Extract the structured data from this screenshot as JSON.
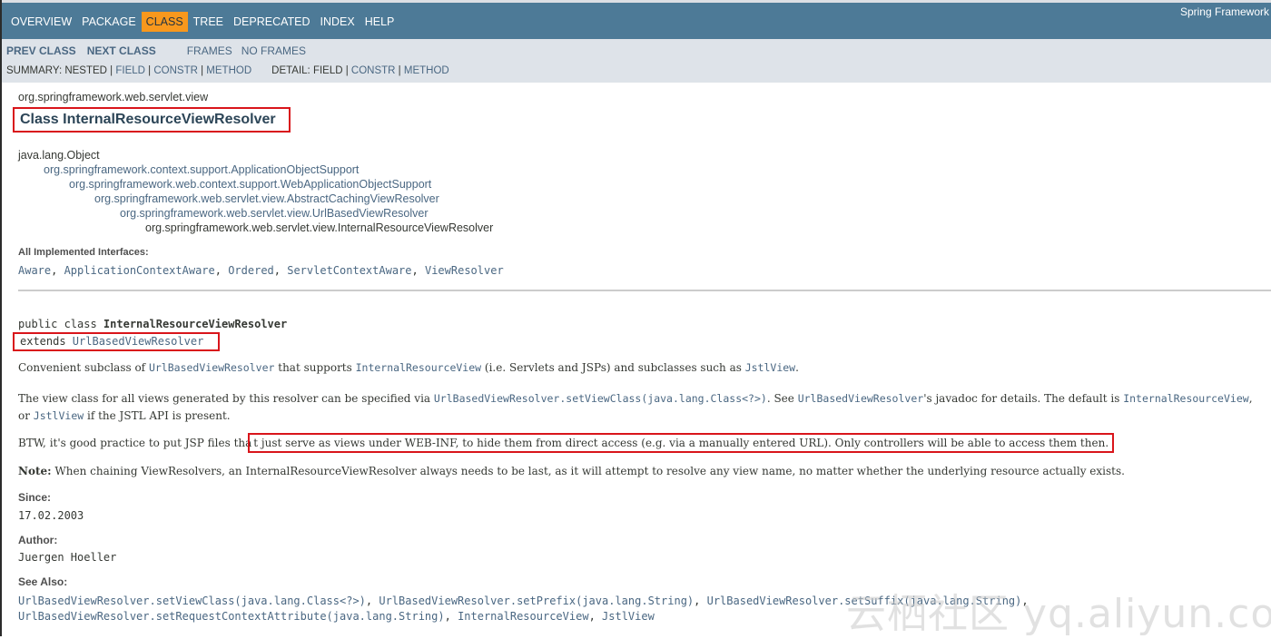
{
  "topnav": {
    "items": [
      {
        "label": "OVERVIEW",
        "active": false
      },
      {
        "label": "PACKAGE",
        "active": false
      },
      {
        "label": "CLASS",
        "active": true
      },
      {
        "label": "TREE",
        "active": false
      },
      {
        "label": "DEPRECATED",
        "active": false
      },
      {
        "label": "INDEX",
        "active": false
      },
      {
        "label": "HELP",
        "active": false
      }
    ],
    "brand": "Spring Framework"
  },
  "subnav": {
    "prev_class": "PREV CLASS",
    "next_class": "NEXT CLASS",
    "frames": "FRAMES",
    "no_frames": "NO FRAMES",
    "summary_label": "SUMMARY: NESTED | ",
    "summary_field": "FIELD",
    "sep": " | ",
    "summary_constr": "CONSTR",
    "summary_method": "METHOD",
    "detail_label": "DETAIL: FIELD | ",
    "detail_constr": "CONSTR",
    "detail_method": "METHOD"
  },
  "header": {
    "package": "org.springframework.web.servlet.view",
    "title": "Class InternalResourceViewResolver"
  },
  "hierarchy": [
    "java.lang.Object",
    "org.springframework.context.support.ApplicationObjectSupport",
    "org.springframework.web.context.support.WebApplicationObjectSupport",
    "org.springframework.web.servlet.view.AbstractCachingViewResolver",
    "org.springframework.web.servlet.view.UrlBasedViewResolver",
    "org.springframework.web.servlet.view.InternalResourceViewResolver"
  ],
  "interfaces": {
    "label": "All Implemented Interfaces:",
    "list": [
      "Aware",
      "ApplicationContextAware",
      "Ordered",
      "ServletContextAware",
      "ViewResolver"
    ]
  },
  "signature": {
    "prefix": "public class ",
    "name": "InternalResourceViewResolver",
    "extends_kw": "extends ",
    "extends_class": "UrlBasedViewResolver"
  },
  "description": {
    "p1": {
      "t1": "Convenient subclass of ",
      "c1": "UrlBasedViewResolver",
      "t2": " that supports ",
      "c2": "InternalResourceView",
      "t3": " (i.e. Servlets and JSPs) and subclasses such as ",
      "c3": "JstlView",
      "t4": "."
    },
    "p2": {
      "t1": "The view class for all views generated by this resolver can be specified via ",
      "c1": "UrlBasedViewResolver.setViewClass(java.lang.Class<?>)",
      "t2": ". See ",
      "c2": "UrlBasedViewResolver",
      "t3": "'s javadoc for details. The default is ",
      "c3": "InternalResourceView",
      "t4": ", or ",
      "c4": "JstlView",
      "t5": " if the JSTL API is present."
    },
    "p3": {
      "t1": "BTW, it's good practice to put JSP files tha",
      "highlight": "t just serve as views under WEB-INF, to hide them from direct access (e.g. via a manually entered URL). Only controllers will be able to access them then."
    },
    "p4": {
      "bold": "Note:",
      "text": " When chaining ViewResolvers, an InternalResourceViewResolver always needs to be last, as it will attempt to resolve any view name, no matter whether the underlying resource actually exists."
    }
  },
  "since": {
    "label": "Since:",
    "value": "17.02.2003"
  },
  "author": {
    "label": "Author:",
    "value": "Juergen Hoeller"
  },
  "see_also": {
    "label": "See Also:",
    "links": [
      "UrlBasedViewResolver.setViewClass(java.lang.Class<?>)",
      "UrlBasedViewResolver.setPrefix(java.lang.String)",
      "UrlBasedViewResolver.setSuffix(java.lang.String)",
      "UrlBasedViewResolver.setRequestContextAttribute(java.lang.String)",
      "InternalResourceView",
      "JstlView"
    ]
  },
  "watermark": "云栖社区 yq.aliyun.com"
}
